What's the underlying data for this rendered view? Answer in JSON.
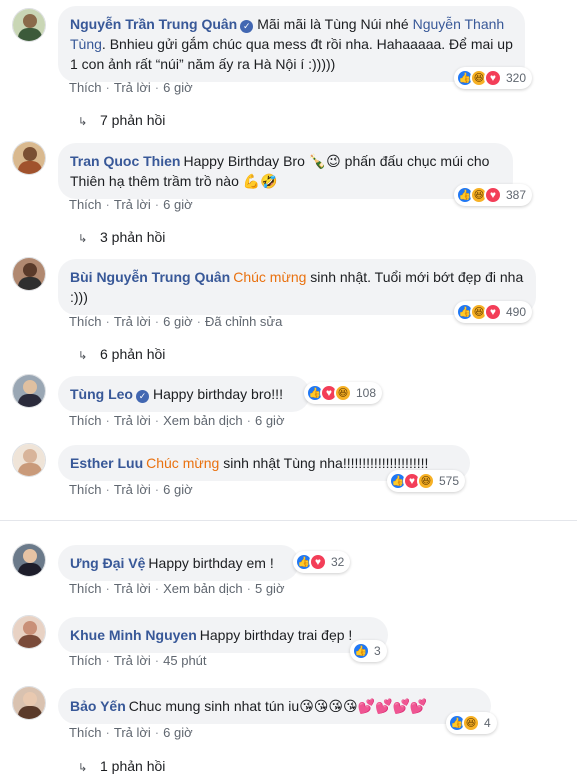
{
  "comments": [
    {
      "name": "Nguyễn Trần Trung Quân",
      "verified": true,
      "text_parts": [
        "Mãi mãi là Tùng Núi nhé ",
        "Nguyễn Thanh Tùng",
        ". Bnhieu gửi gắm chúc qua mess đt rồi nha. Hahaaaaa. Để mai up 1 con ảnh rất “núi” năm ấy ra Hà Nội í :)))))"
      ],
      "actions": [
        "Thích",
        "Trả lời",
        "6 giờ"
      ],
      "reaction_count": "320",
      "replies": "7 phản hồi"
    },
    {
      "name": "Tran Quoc Thien",
      "text": "Happy Birthday Bro 🍾😉 phấn đấu chục múi cho Thiên hạ thêm trầm trồ nào 💪🤣",
      "actions": [
        "Thích",
        "Trả lời",
        "6 giờ"
      ],
      "reaction_count": "387",
      "replies": "3 phản hồi"
    },
    {
      "name": "Bùi Nguyễn Trung Quân",
      "tag": "Chúc mừng",
      "text": " sinh nhật. Tuổi mới bớt đẹp đi nha :)))",
      "actions": [
        "Thích",
        "Trả lời",
        "6 giờ",
        "Đã chỉnh sửa"
      ],
      "reaction_count": "490",
      "replies": "6 phản hồi"
    },
    {
      "name": "Tùng Leo",
      "verified": true,
      "text": "Happy birthday bro!!!",
      "actions": [
        "Thích",
        "Trả lời",
        "Xem bản dịch",
        "6 giờ"
      ],
      "reaction_count": "108"
    },
    {
      "name": "Esther Luu",
      "tag": "Chúc mừng",
      "text": " sinh nhật Tùng nha!!!!!!!!!!!!!!!!!!!!!!",
      "actions": [
        "Thích",
        "Trả lời",
        "6 giờ"
      ],
      "reaction_count": "575"
    },
    {
      "name": "Ưng Đại Vệ",
      "text": "Happy birthday em !",
      "actions": [
        "Thích",
        "Trả lời",
        "Xem bản dịch",
        "5 giờ"
      ],
      "reaction_count": "32"
    },
    {
      "name": "Khue Minh Nguyen",
      "text": "Happy birthday trai đẹp !",
      "actions": [
        "Thích",
        "Trả lời",
        "45 phút"
      ],
      "reaction_count": "3"
    },
    {
      "name": "Bảo Yến",
      "text": "Chuc mung sinh nhat tún iu😘😘😘😘💕💕💕💕",
      "actions": [
        "Thích",
        "Trả lời",
        "6 giờ"
      ],
      "reaction_count": "4",
      "replies": "1 phản hồi"
    }
  ],
  "colors": {
    "link": "#385898",
    "tag": "#e9710f",
    "bubble": "#f2f3f5",
    "like": "#2078f4",
    "love": "#f33e58",
    "haha": "#f7b125"
  },
  "icons": {
    "verified": "verified-badge-icon",
    "reply_arrow": "reply-arrow-icon"
  }
}
